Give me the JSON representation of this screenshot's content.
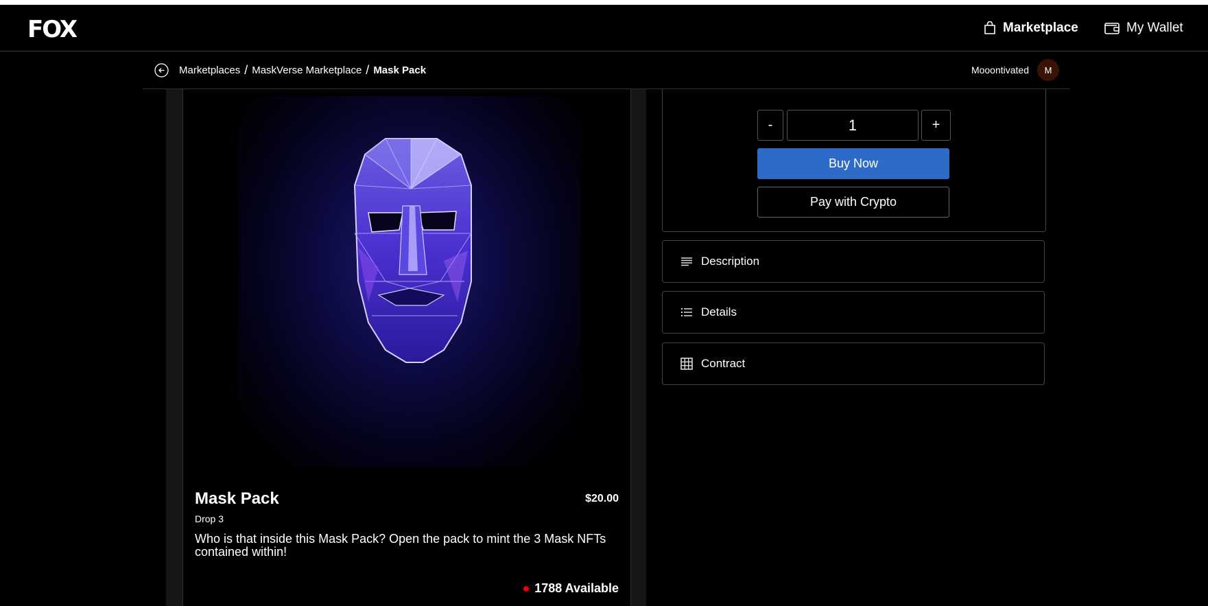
{
  "header": {
    "logo": "FOX",
    "nav": [
      {
        "label": "Marketplace",
        "icon": "shopping-bag-icon"
      },
      {
        "label": "My Wallet",
        "icon": "wallet-icon"
      }
    ]
  },
  "breadcrumb": {
    "items": [
      "Marketplaces",
      "MaskVerse Marketplace",
      "Mask Pack"
    ],
    "separator": "/"
  },
  "user": {
    "name": "Mooontivated",
    "avatar_initial": "M"
  },
  "product": {
    "title": "Mask Pack",
    "price": "$20.00",
    "drop": "Drop 3",
    "description": "Who is that inside this Mask Pack? Open the pack to mint the 3 Mask NFTs contained within!",
    "available": "1788 Available"
  },
  "purchase": {
    "minus_label": "-",
    "quantity": "1",
    "plus_label": "+",
    "buy_now_label": "Buy Now",
    "crypto_label": "Pay with Crypto"
  },
  "accordions": [
    {
      "label": "Description",
      "icon": "lines-icon"
    },
    {
      "label": "Details",
      "icon": "list-icon"
    },
    {
      "label": "Contract",
      "icon": "grid-icon"
    }
  ],
  "colors": {
    "accent": "#2e6bc9",
    "available_dot": "#ee0000",
    "avatar_bg": "#3a1206"
  }
}
